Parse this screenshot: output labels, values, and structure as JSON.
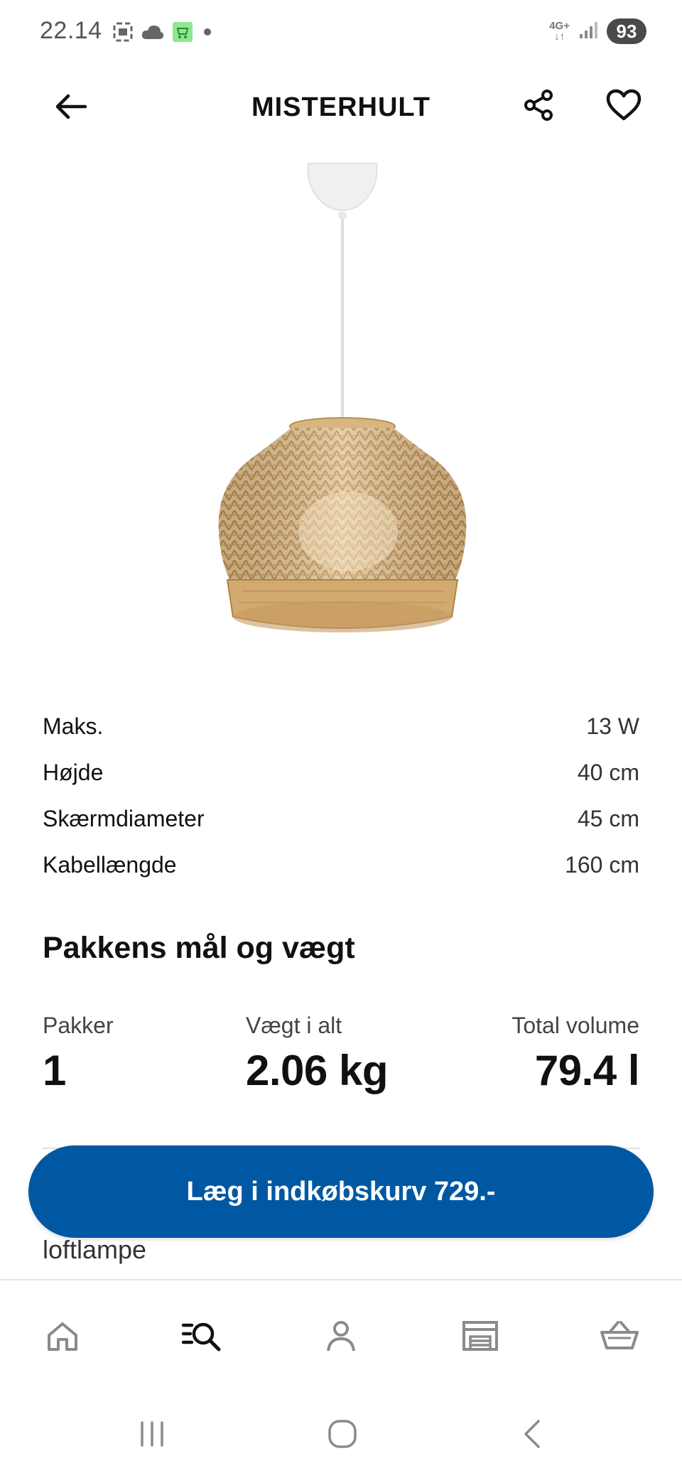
{
  "status_bar": {
    "time": "22.14",
    "network": "4G+",
    "battery": "93",
    "icons": [
      "screenshot-icon",
      "cloud-icon",
      "shop-app-icon",
      "notification-dot-icon",
      "signal-icon"
    ]
  },
  "header": {
    "title": "MISTERHULT",
    "icons": [
      "back-arrow-icon",
      "share-icon",
      "heart-icon"
    ]
  },
  "specs": [
    {
      "label": "Maks.",
      "value": "13 W"
    },
    {
      "label": "Højde",
      "value": "40 cm"
    },
    {
      "label": "Skærmdiameter",
      "value": "45 cm"
    },
    {
      "label": "Kabellængde",
      "value": "160 cm"
    }
  ],
  "package_section": {
    "title": "Pakkens mål og vægt",
    "items": [
      {
        "label": "Pakker",
        "value": "1"
      },
      {
        "label": "Vægt i alt",
        "value": "2.06 kg"
      },
      {
        "label": "Total volume",
        "value": "79.4 l"
      }
    ]
  },
  "below_text": "loftlampe",
  "cart_button": {
    "label": "Læg i indkøbskurv 729.-"
  },
  "bottom_nav": {
    "items": [
      "home-icon",
      "search-browse-icon",
      "profile-icon",
      "store-icon",
      "basket-icon"
    ],
    "active": "search-browse-icon"
  },
  "colors": {
    "accent": "#0058a3",
    "text": "#111111",
    "icon_inactive": "#8a8a8a"
  }
}
